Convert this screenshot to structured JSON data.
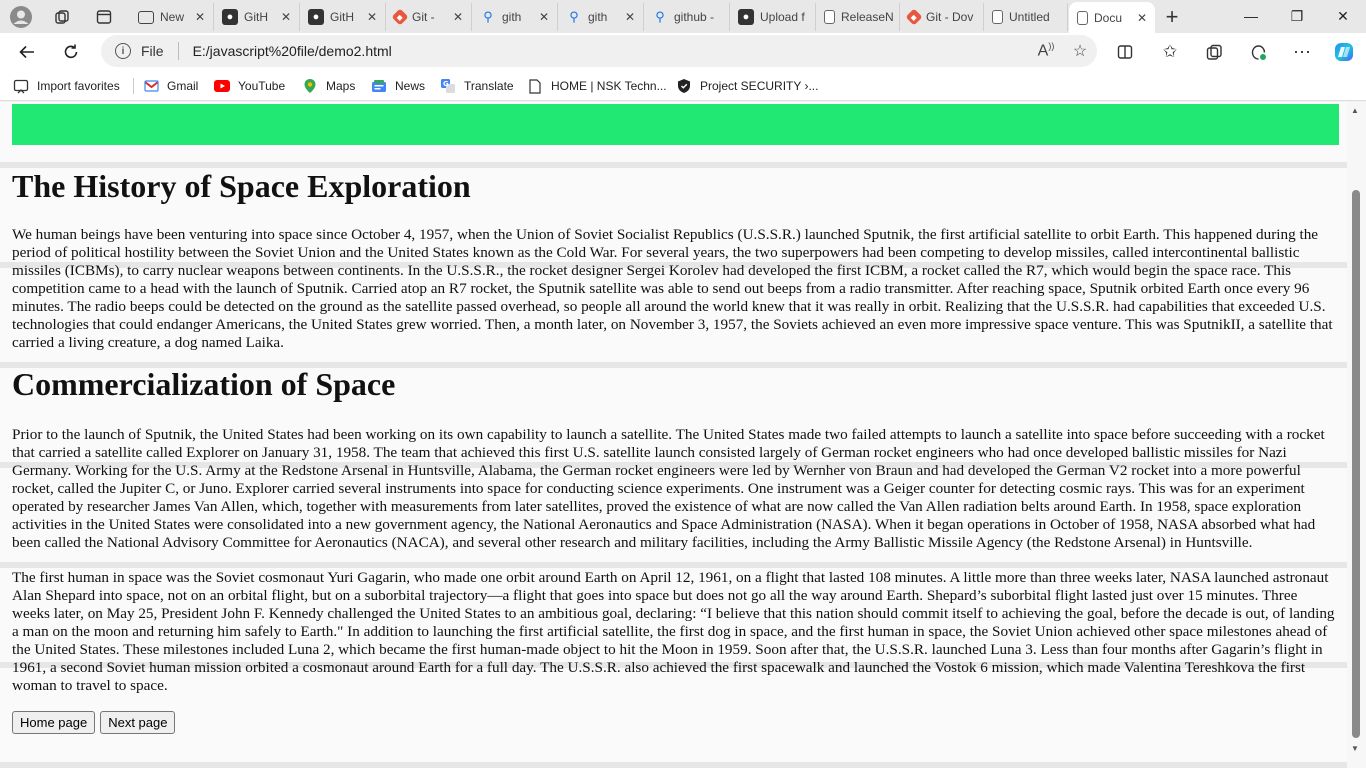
{
  "tabs": [
    {
      "label": "New",
      "icon": "news-icon"
    },
    {
      "label": "GitH",
      "icon": "github-icon"
    },
    {
      "label": "GitH",
      "icon": "github-icon"
    },
    {
      "label": "Git -",
      "icon": "git-icon"
    },
    {
      "label": "gith",
      "icon": "search-icon"
    },
    {
      "label": "gith",
      "icon": "search-icon"
    },
    {
      "label": "github -",
      "icon": "search-icon"
    },
    {
      "label": "Upload f",
      "icon": "github-icon"
    },
    {
      "label": "ReleaseN",
      "icon": "document-icon"
    },
    {
      "label": "Git - Dov",
      "icon": "git-icon"
    },
    {
      "label": "Untitled",
      "icon": "document-icon"
    },
    {
      "label": "Docu",
      "icon": "document-icon",
      "active": true
    }
  ],
  "address_bar": {
    "scheme_label": "File",
    "url": "E:/javascript%20file/demo2.html"
  },
  "favorites": [
    {
      "label": "Import favorites",
      "icon": "import-icon"
    },
    {
      "label": "Gmail",
      "icon": "gmail-icon"
    },
    {
      "label": "YouTube",
      "icon": "youtube-icon"
    },
    {
      "label": "Maps",
      "icon": "maps-icon"
    },
    {
      "label": "News",
      "icon": "news-icon"
    },
    {
      "label": "Translate",
      "icon": "translate-icon"
    },
    {
      "label": "HOME | NSK Techn...",
      "icon": "document-icon"
    },
    {
      "label": "Project SECURITY ›...",
      "icon": "shield-icon"
    }
  ],
  "page": {
    "heading1": "The History of Space Exploration",
    "para1": "We human beings have been venturing into space since October 4, 1957, when the Union of Soviet Socialist Republics (U.S.S.R.) launched Sputnik, the first artificial satellite to orbit Earth. This happened during the period of political hostility between the Soviet Union and the United States known as the Cold War. For several years, the two superpowers had been competing to develop missiles, called intercontinental ballistic missiles (ICBMs), to carry nuclear weapons between continents. In the U.S.S.R., the rocket designer Sergei Korolev had developed the first ICBM, a rocket called the R7, which would begin the space race. This competition came to a head with the launch of Sputnik. Carried atop an R7 rocket, the Sputnik satellite was able to send out beeps from a radio transmitter. After reaching space, Sputnik orbited Earth once every 96 minutes. The radio beeps could be detected on the ground as the satellite passed overhead, so people all around the world knew that it was really in orbit. Realizing that the U.S.S.R. had capabilities that exceeded U.S. technologies that could endanger Americans, the United States grew worried. Then, a month later, on November 3, 1957, the Soviets achieved an even more impressive space venture. This was SputnikII, a satellite that carried a living creature, a dog named Laika.",
    "heading2": "Commercialization of Space",
    "para2": "Prior to the launch of Sputnik, the United States had been working on its own capability to launch a satellite. The United States made two failed attempts to launch a satellite into space before succeeding with a rocket that carried a satellite called Explorer on January 31, 1958. The team that achieved this first U.S. satellite launch consisted largely of German rocket engineers who had once developed ballistic missiles for Nazi Germany. Working for the U.S. Army at the Redstone Arsenal in Huntsville, Alabama, the German rocket engineers were led by Wernher von Braun and had developed the German V2 rocket into a more powerful rocket, called the Jupiter C, or Juno. Explorer carried several instruments into space for conducting science experiments. One instrument was a Geiger counter for detecting cosmic rays. This was for an experiment operated by researcher James Van Allen, which, together with measurements from later satellites, proved the existence of what are now called the Van Allen radiation belts around Earth. In 1958, space exploration activities in the United States were consolidated into a new government agency, the National Aeronautics and Space Administration (NASA). When it began operations in October of 1958, NASA absorbed what had been called the National Advisory Committee for Aeronautics (NACA), and several other research and military facilities, including the Army Ballistic Missile Agency (the Redstone Arsenal) in Huntsville.",
    "para3": "The first human in space was the Soviet cosmonaut Yuri Gagarin, who made one orbit around Earth on April 12, 1961, on a flight that lasted 108 minutes. A little more than three weeks later, NASA launched astronaut Alan Shepard into space, not on an orbital flight, but on a suborbital trajectory—a flight that goes into space but does not go all the way around Earth. Shepard’s suborbital flight lasted just over 15 minutes. Three weeks later, on May 25, President John F. Kennedy challenged the United States to an ambitious goal, declaring: “I believe that this nation should commit itself to achieving the goal, before the decade is out, of landing a man on the moon and returning him safely to Earth.\" In addition to launching the first artificial satellite, the first dog in space, and the first human in space, the Soviet Union achieved other space milestones ahead of the United States. These milestones included Luna 2, which became the first human-made object to hit the Moon in 1959. Soon after that, the U.S.S.R. launched Luna 3. Less than four months after Gagarin’s flight in 1961, a second Soviet human mission orbited a cosmonaut around Earth for a full day. The U.S.S.R. also achieved the first spacewalk and launched the Vostok 6 mission, which made Valentina Tereshkova the first woman to travel to space.",
    "buttons": {
      "home": "Home page",
      "next": "Next page"
    }
  },
  "colors": {
    "banner": "#21e873"
  }
}
